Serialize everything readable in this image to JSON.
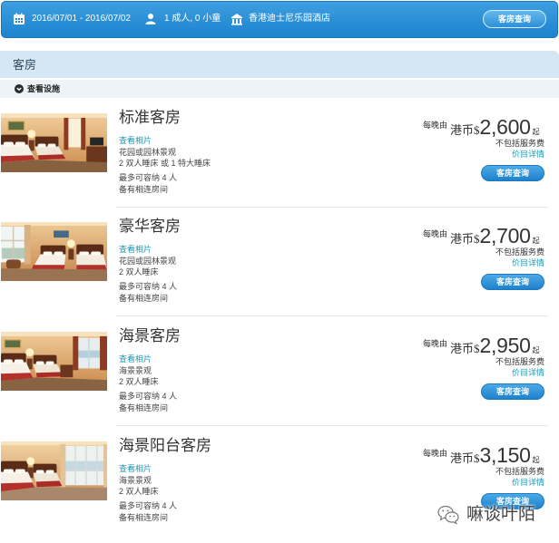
{
  "search_bar": {
    "dates": "2016/07/01 - 2016/07/02",
    "guests": "1 成人, 0 小童",
    "hotel": "香港迪士尼乐园酒店",
    "search_button": "客房查询"
  },
  "icons": {
    "dates": "calendar-icon",
    "guests": "person-icon",
    "hotel": "building-icon",
    "facilities": "chevron-down-circle-icon",
    "watermark": "wechat-icon"
  },
  "section": {
    "title": "客房",
    "facilities_link": "查看设施"
  },
  "rooms": [
    {
      "name": "标准客房",
      "photos_link": "查看相片",
      "view": "花园或园林景观",
      "beds": "2 双人睡床 或 1 特大睡床",
      "capacity": "最多可容纳 4 人",
      "connecting": "备有相连房间",
      "per_night": "每晚由",
      "currency": "港币$",
      "price": "2,600",
      "from": "起",
      "note": "不包括服务费",
      "price_details": "价目详情",
      "button": "客房查询"
    },
    {
      "name": "豪华客房",
      "photos_link": "查看相片",
      "view": "花园或园林景观",
      "beds": "2 双人睡床",
      "capacity": "最多可容纳 4 人",
      "connecting": "备有相连房间",
      "per_night": "每晚由",
      "currency": "港币$",
      "price": "2,700",
      "from": "起",
      "note": "不包括服务费",
      "price_details": "价目详情",
      "button": "客房查询"
    },
    {
      "name": "海景客房",
      "photos_link": "查看相片",
      "view": "海景景观",
      "beds": "2 双人睡床",
      "capacity": "最多可容纳 4 人",
      "connecting": "备有相连房间",
      "per_night": "每晚由",
      "currency": "港币$",
      "price": "2,950",
      "from": "起",
      "note": "不包括服务费",
      "price_details": "价目详情",
      "button": "客房查询"
    },
    {
      "name": "海景阳台客房",
      "photos_link": "查看相片",
      "view": "海景景观",
      "beds": "2 双人睡床",
      "capacity": "最多可容纳 4 人",
      "connecting": "备有相连房间",
      "per_night": "每晚由",
      "currency": "港币$",
      "price": "3,150",
      "from": "起",
      "note": "不包括服务费",
      "price_details": "价目详情",
      "button": "客房查询"
    }
  ],
  "watermark": {
    "text": "嘛谈叶陌"
  },
  "colors": {
    "top_bar": "#2a8ed8",
    "section_header": "#d5e6f4",
    "link": "#1a9ab6",
    "button": "#2a8ad4",
    "text": "#333333"
  }
}
